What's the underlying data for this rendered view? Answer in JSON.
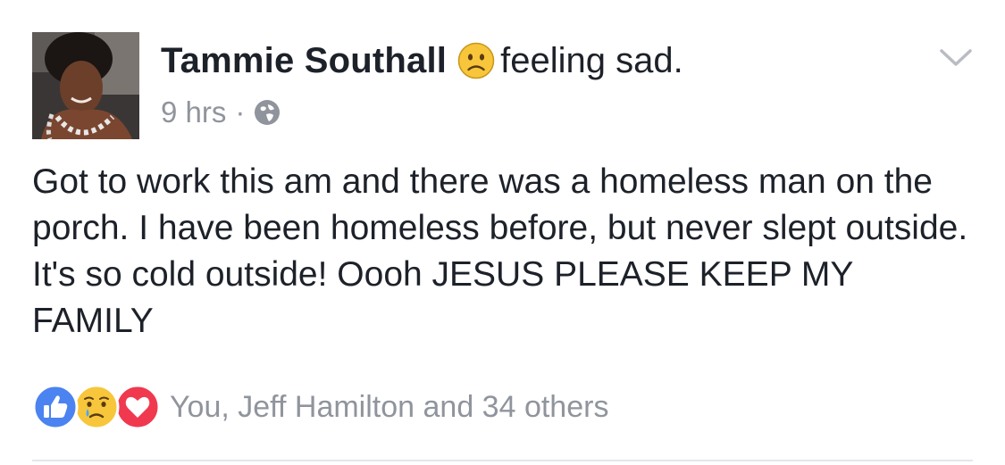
{
  "post": {
    "author": "Tammie Southall",
    "feeling_text": "feeling sad.",
    "feeling_icon": "sad-face-icon",
    "timestamp": "9 hrs",
    "separator": "·",
    "audience_icon": "globe-icon",
    "menu_icon": "chevron-down-icon",
    "body": "Got to work this am and there was a homeless man on the porch. I have been homeless before, but never slept outside. It's so cold outside! Oooh JESUS PLEASE KEEP MY FAMILY"
  },
  "reactions": {
    "icons": [
      "like-icon",
      "sad-icon",
      "love-icon"
    ],
    "summary": "You, Jeff Hamilton and 34 others"
  },
  "colors": {
    "text": "#1d2129",
    "meta": "#90949c",
    "like_blue": "#4b83f0",
    "love_red": "#f0394f",
    "emoji_yellow": "#f7c63b",
    "divider": "#e5e6e9"
  }
}
